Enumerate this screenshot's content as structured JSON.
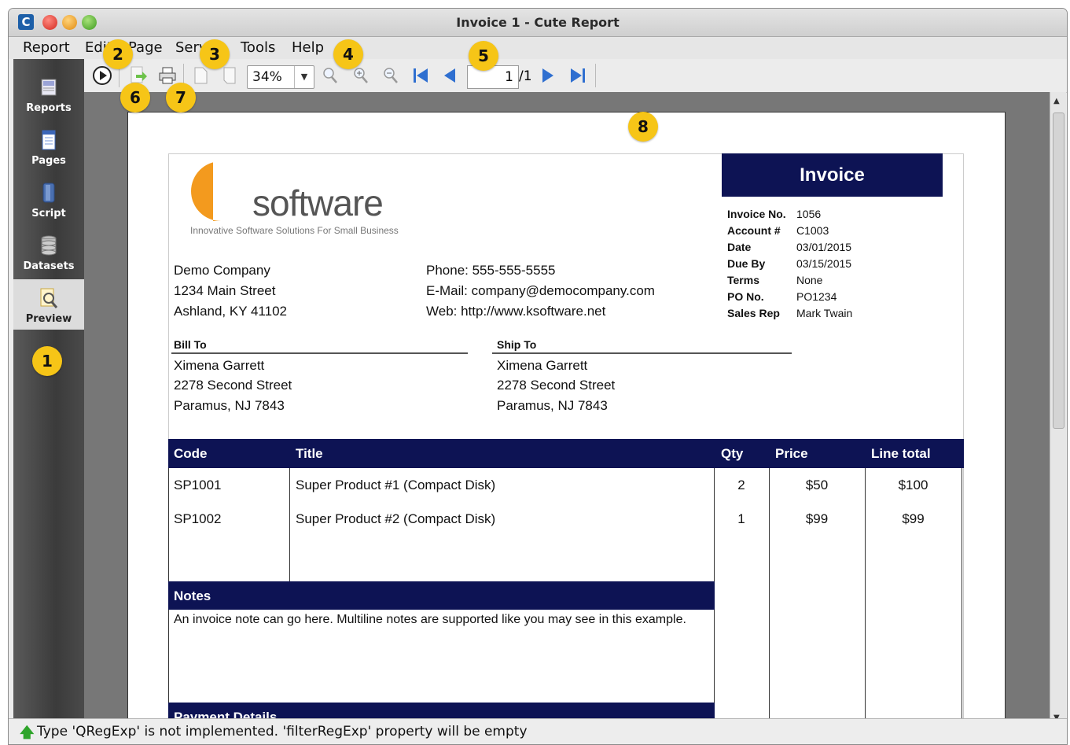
{
  "window": {
    "title": "Invoice 1 - Cute Report"
  },
  "menu": [
    "Report",
    "Edit",
    "Page",
    "Service",
    "Tools",
    "Help"
  ],
  "toolbar": {
    "zoom": "34%",
    "page_current": "1",
    "page_total": "/1"
  },
  "sidebar": {
    "items": [
      {
        "label": "Reports",
        "icon": "reports-icon"
      },
      {
        "label": "Pages",
        "icon": "pages-icon"
      },
      {
        "label": "Script",
        "icon": "script-icon"
      },
      {
        "label": "Datasets",
        "icon": "datasets-icon"
      },
      {
        "label": "Preview",
        "icon": "preview-icon"
      }
    ]
  },
  "callouts": [
    "1",
    "2",
    "3",
    "4",
    "5",
    "6",
    "7",
    "8"
  ],
  "invoice": {
    "logo": {
      "brand": "software",
      "tagline": "Innovative Software Solutions For Small Business"
    },
    "header_title": "Invoice",
    "details": [
      {
        "k": "Invoice No.",
        "v": "1056"
      },
      {
        "k": "Account #",
        "v": "C1003"
      },
      {
        "k": "Date",
        "v": "03/01/2015"
      },
      {
        "k": "Due By",
        "v": "03/15/2015"
      },
      {
        "k": "Terms",
        "v": "None"
      },
      {
        "k": "PO No.",
        "v": "PO1234"
      },
      {
        "k": "Sales Rep",
        "v": "Mark Twain"
      }
    ],
    "company": [
      "Demo Company",
      "1234 Main Street",
      "Ashland, KY 41102"
    ],
    "contact": [
      "Phone:  555-555-5555",
      "E-Mail: company@democompany.com",
      "Web: http://www.ksoftware.net"
    ],
    "bill_to": {
      "heading": "Bill To",
      "lines": [
        "Ximena Garrett",
        "2278 Second Street",
        "Paramus, NJ 7843"
      ]
    },
    "ship_to": {
      "heading": "Ship To",
      "lines": [
        "Ximena Garrett",
        "2278 Second Street",
        "Paramus, NJ 7843"
      ]
    },
    "table": {
      "headers": [
        "Code",
        "Title",
        "Qty",
        "Price",
        "Line total"
      ],
      "rows": [
        [
          "SP1001",
          "Super Product #1 (Compact Disk)",
          "2",
          "$50",
          "$100"
        ],
        [
          "SP1002",
          "Super Product #2 (Compact Disk)",
          "1",
          "$99",
          "$99"
        ]
      ]
    },
    "notes": {
      "heading": "Notes",
      "text": "An invoice note can go here. Multiline notes are supported like you may see in this example."
    },
    "payment": {
      "heading": "Payment Details"
    }
  },
  "status": {
    "text": "Type 'QRegExp' is not implemented. 'filterRegExp' property will be empty"
  }
}
